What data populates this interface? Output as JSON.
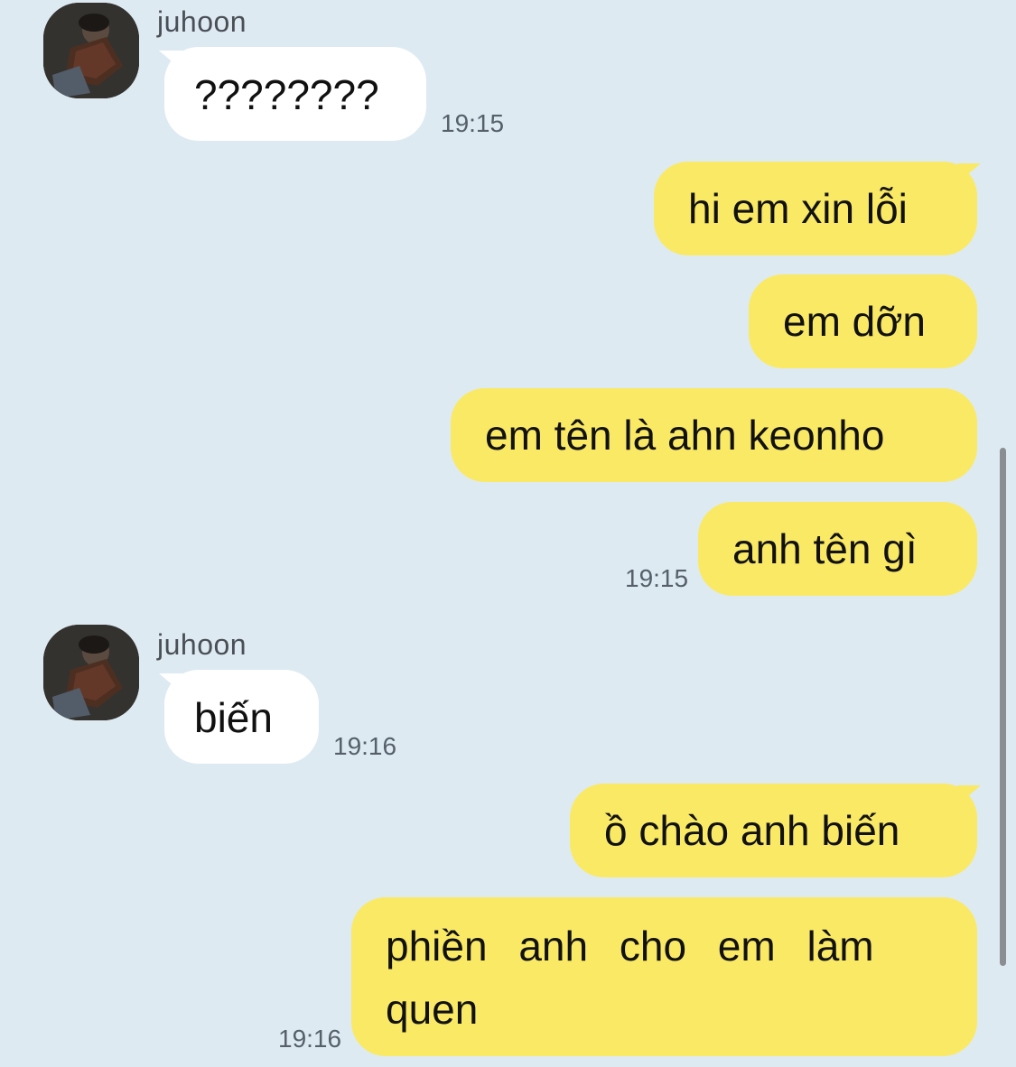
{
  "messages": [
    {
      "sender": "juhoon",
      "text": "????????",
      "time": "19:15"
    },
    {
      "text": "hi em xin lỗi"
    },
    {
      "text": "em dỡn"
    },
    {
      "text": "em tên là ahn keonho"
    },
    {
      "text": "anh tên gì",
      "time": "19:15"
    },
    {
      "sender": "juhoon",
      "text": "biến",
      "time": "19:16"
    },
    {
      "text": "ồ chào anh biến"
    },
    {
      "text_line1": "phiền anh cho em làm",
      "text_line2": "quen",
      "time": "19:16"
    }
  ],
  "colors": {
    "background": "#deeaf2",
    "incoming_bubble": "#ffffff",
    "outgoing_bubble": "#fae965"
  },
  "icons": {
    "avatar": "profile-photo",
    "scrollbar": "vertical-scrollbar"
  }
}
